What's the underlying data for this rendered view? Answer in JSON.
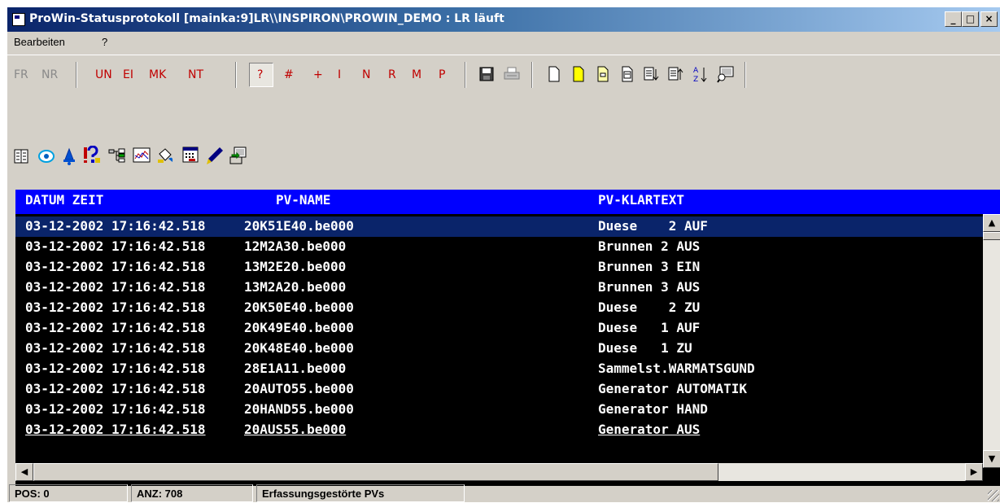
{
  "window": {
    "title": "ProWin-Statusprotokoll [mainka:9]LR\\\\INSPIRON\\PROWIN_DEMO : LR läuft",
    "minimize_label": "_",
    "restore_label": "□",
    "close_label": "×"
  },
  "menu": {
    "items": [
      "Bearbeiten",
      "?"
    ]
  },
  "toolbar": {
    "text_buttons": [
      "FR",
      "NR",
      "UN",
      "EI",
      "MK",
      "NT",
      "?",
      "#",
      "+",
      "I",
      "N",
      "R",
      "M",
      "P"
    ],
    "icons": [
      "save-icon",
      "print-icon",
      "blank-page-icon",
      "yellow-page-icon",
      "page-minus-icon",
      "page-lines-icon",
      "sort-down-icon",
      "sort-up-icon",
      "az-sort-icon",
      "monitor-search-icon"
    ]
  },
  "toolbar2": {
    "icons": [
      "list-book-icon",
      "eye-icon",
      "bell-icon",
      "alarm-shapes-icon",
      "tree-icon",
      "chart-icon",
      "paint-bucket-icon",
      "calendar-icon",
      "pen-icon",
      "export-icon"
    ]
  },
  "list": {
    "headers": [
      "DATUM ZEIT",
      "PV-NAME",
      "PV-KLARTEXT"
    ],
    "rows": [
      [
        "03-12-2002 17:16:42.518",
        "20K51E40.be000",
        "Duese    2 AUF"
      ],
      [
        "03-12-2002 17:16:42.518",
        "12M2A30.be000",
        "Brunnen 2 AUS"
      ],
      [
        "03-12-2002 17:16:42.518",
        "13M2E20.be000",
        "Brunnen 3 EIN"
      ],
      [
        "03-12-2002 17:16:42.518",
        "13M2A20.be000",
        "Brunnen 3 AUS"
      ],
      [
        "03-12-2002 17:16:42.518",
        "20K50E40.be000",
        "Duese    2 ZU"
      ],
      [
        "03-12-2002 17:16:42.518",
        "20K49E40.be000",
        "Duese   1 AUF"
      ],
      [
        "03-12-2002 17:16:42.518",
        "20K48E40.be000",
        "Duese   1 ZU"
      ],
      [
        "03-12-2002 17:16:42.518",
        "28E1A11.be000",
        "Sammelst.WARMATSGUND"
      ],
      [
        "03-12-2002 17:16:42.518",
        "20AUTO55.be000",
        "Generator AUTOMATIK"
      ],
      [
        "03-12-2002 17:16:42.518",
        "20HAND55.be000",
        "Generator HAND"
      ],
      [
        "03-12-2002 17:16:42.518",
        "20AUS55.be000",
        "Generator AUS"
      ]
    ],
    "selected_row": 0
  },
  "status": {
    "pos": "POS: 0",
    "count": "ANZ: 708",
    "filter": "Erfassungsgestörte PVs"
  },
  "colors": {
    "title_gradient_start": "#0a246a",
    "header_blue": "#0000ff",
    "list_bg": "#000000",
    "toolbar_red": "#c00000",
    "toolbar_grey": "#8a8a8a"
  }
}
